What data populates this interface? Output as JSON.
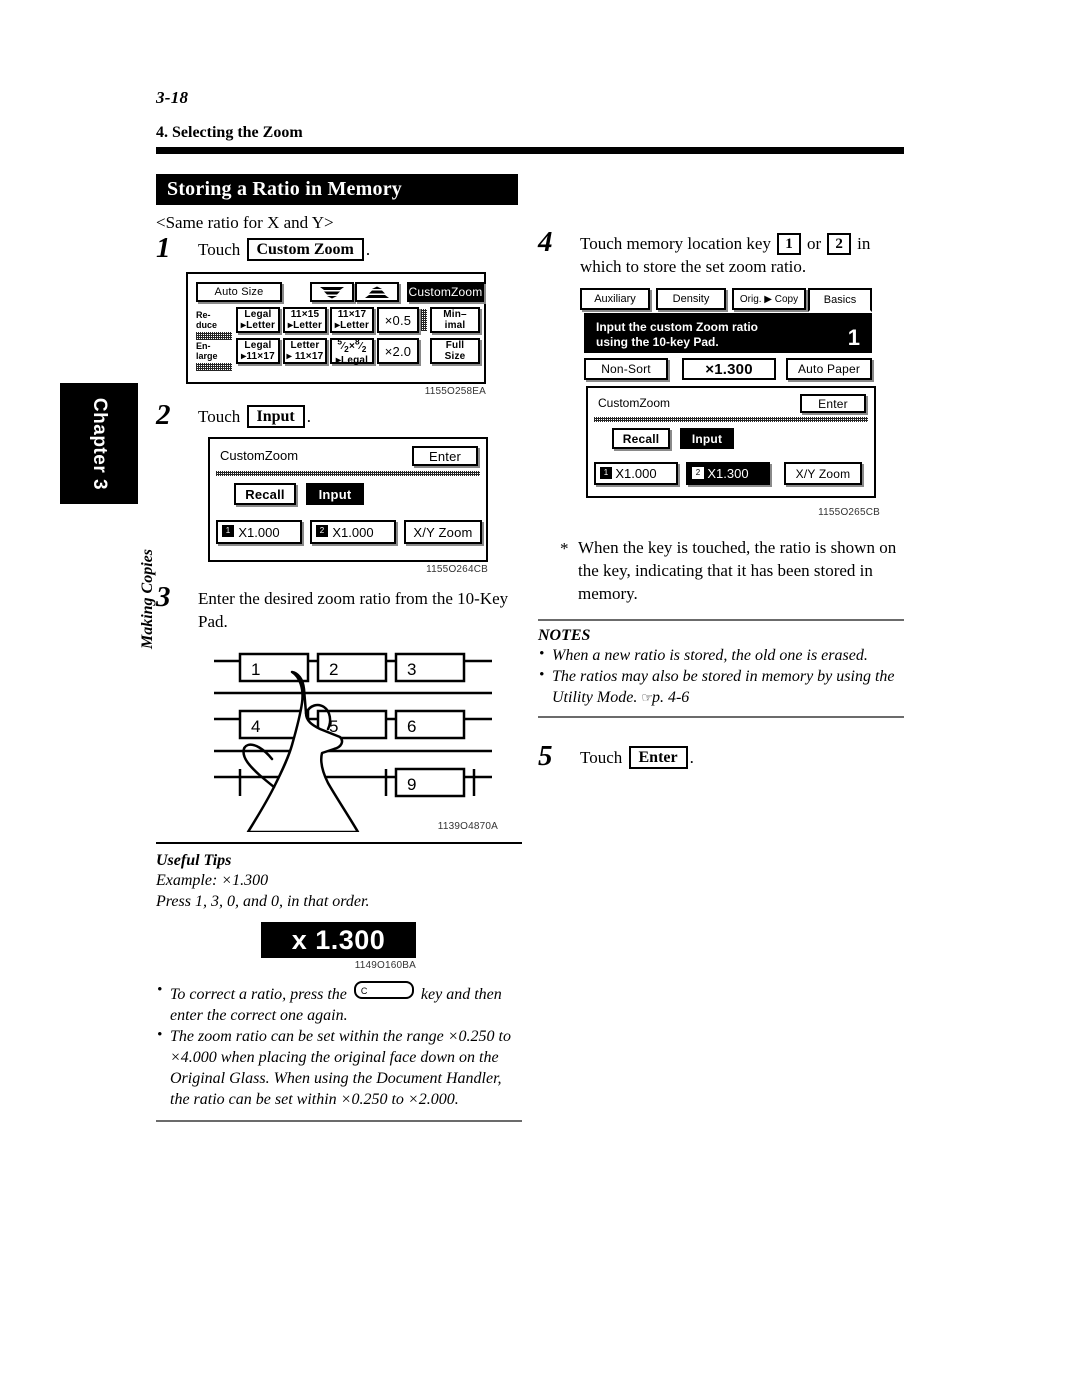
{
  "header": {
    "folio": "3-18",
    "running_head": "4. Selecting the Zoom"
  },
  "chapter_tab": {
    "label": "Chapter 3",
    "subtitle": "Making Copies"
  },
  "section": {
    "title": "Storing a Ratio in Memory",
    "subhead": "<Same ratio for X and Y>"
  },
  "steps": {
    "step1": {
      "num": "1",
      "text_before": "Touch",
      "key": "Custom Zoom",
      "text_after": "."
    },
    "step2": {
      "num": "2",
      "text_before": "Touch",
      "key": "Input",
      "text_after": "."
    },
    "step3": {
      "num": "3",
      "text": "Enter the desired zoom ratio from the 10-Key Pad."
    },
    "step4": {
      "num": "4",
      "text_before": "Touch memory location key",
      "key1": "1",
      "text_mid": "or",
      "key2": "2",
      "text_after": "in which to store the set zoom ratio."
    },
    "step5": {
      "num": "5",
      "text_before": "Touch",
      "key": "Enter",
      "text_after": "."
    }
  },
  "figure1": {
    "id": "1155O258EA",
    "top_row": {
      "auto_size": "Auto Size",
      "icon_down": "zoom-out-icon",
      "icon_up": "zoom-in-icon",
      "custom_zoom": "CustomZoom"
    },
    "reduce_label": "Re-\nduce",
    "enlarge_label": "En-\nlarge",
    "reduce_keys": [
      {
        "l1": "Legal",
        "l2": "▸Letter"
      },
      {
        "l1": "11×15",
        "l2": "▸Letter"
      },
      {
        "l1": "11×17",
        "l2": "▸Letter"
      }
    ],
    "reduce_ratio": "×0.5",
    "minimal": "Min-\nimal",
    "enlarge_keys": [
      {
        "l1": "Legal",
        "l2": "▸11×17"
      },
      {
        "l1": "Letter",
        "l2": "▸ 11×17"
      },
      {
        "l1": "5⁄₂×8⁄₂",
        "l2": "▸Legal"
      }
    ],
    "enlarge_ratio": "×2.0",
    "full_size": "Full\nSize"
  },
  "figure2": {
    "id": "1155O264CB",
    "title": "CustomZoom",
    "enter": "Enter",
    "recall": "Recall",
    "input": "Input",
    "mem1_badge": "1",
    "mem1": "X1.000",
    "mem2_badge": "2",
    "mem2": "X1.000",
    "xy_zoom": "X/Y Zoom"
  },
  "figure3": {
    "id": "1139O4870A",
    "keys": [
      "1",
      "2",
      "3",
      "4",
      "5",
      "6",
      "9"
    ],
    "caption": "hand-pressing-key-1-illustration"
  },
  "figure4": {
    "id": "1155O265CB",
    "tabs": [
      "Auxiliary",
      "Density",
      "Orig. ▶ Copy",
      "Basics"
    ],
    "message_line1": "Input the custom Zoom ratio",
    "message_line2": "using the 10-key Pad.",
    "message_number": "1",
    "non_sort": "Non-Sort",
    "ratio_display": "×1.300",
    "auto_paper": "Auto Paper",
    "title": "CustomZoom",
    "enter": "Enter",
    "recall": "Recall",
    "input": "Input",
    "mem1_badge": "1",
    "mem1": "X1.000",
    "mem2_badge": "2",
    "mem2": "X1.300",
    "xy_zoom": "X/Y Zoom"
  },
  "figure5": {
    "id": "1149O160BA",
    "ratio": "x 1.300"
  },
  "useful_tips": {
    "heading": "Useful Tips",
    "line1": "Example: ×1.300",
    "line2": "Press 1, 3, 0, and 0, in that order.",
    "bullet1_a": "To correct a ratio, press the",
    "bullet1_key": "C",
    "bullet1_b": "key and then enter the correct one again.",
    "bullet2": "The zoom ratio can be set within the range ×0.250 to ×4.000 when placing the original face down on the Original Glass. When using the Document Handler, the ratio can be set within ×0.250 to ×2.000."
  },
  "right_notes": {
    "star_note": "When the key is touched, the ratio is shown on the key, indicating that it has been stored in memory.",
    "notes_heading": "NOTES",
    "note1": "When a new ratio is stored, the old one is erased.",
    "note2_a": "The ratios may also be stored in memory by using the Utility Mode.",
    "note2_ref": "p. 4-6"
  }
}
